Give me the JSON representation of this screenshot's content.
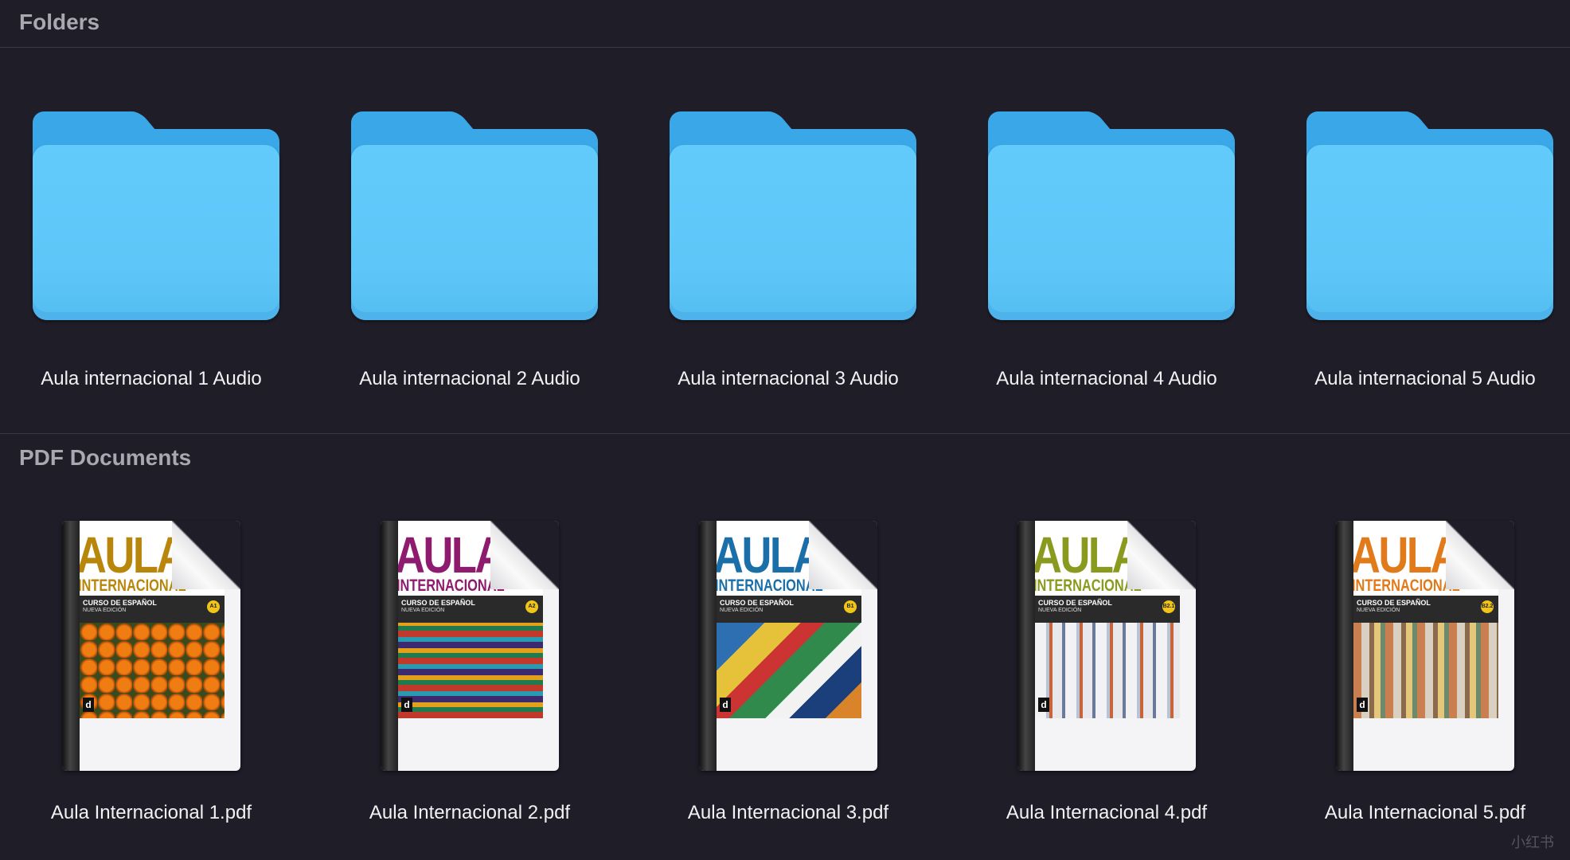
{
  "sections": {
    "folders": {
      "title": "Folders",
      "items": [
        {
          "label": "Aula internacional 1 Audio",
          "icon": "folder-icon",
          "color": "#5ec6f8"
        },
        {
          "label": "Aula internacional 2 Audio",
          "icon": "folder-icon",
          "color": "#5ec6f8"
        },
        {
          "label": "Aula internacional 3 Audio",
          "icon": "folder-icon",
          "color": "#5ec6f8"
        },
        {
          "label": "Aula internacional 4 Audio",
          "icon": "folder-icon",
          "color": "#5ec6f8"
        },
        {
          "label": "Aula internacional 5 Audio",
          "icon": "folder-icon",
          "color": "#5ec6f8"
        }
      ]
    },
    "pdfs": {
      "title": "PDF Documents",
      "items": [
        {
          "label": "Aula Internacional 1.pdf",
          "icon": "pdf-document-icon",
          "cover": {
            "title": "AULA",
            "subtitle": "INTERNACIONAL",
            "band_text": "CURSO DE ESPAÑOL",
            "band_sub": "NUEVA EDICIÓN",
            "level": "A1",
            "accent": "#b8860b",
            "level_color": "#f0c419",
            "photo": "oranges"
          }
        },
        {
          "label": "Aula Internacional 2.pdf",
          "icon": "pdf-document-icon",
          "cover": {
            "title": "AULA",
            "subtitle": "INTERNACIONAL",
            "band_text": "CURSO DE ESPAÑOL",
            "band_sub": "NUEVA EDICIÓN",
            "level": "A2",
            "accent": "#8e1b6e",
            "level_color": "#f0c419",
            "photo": "textiles"
          }
        },
        {
          "label": "Aula Internacional 3.pdf",
          "icon": "pdf-document-icon",
          "cover": {
            "title": "AULA",
            "subtitle": "INTERNACIONAL",
            "band_text": "CURSO DE ESPAÑOL",
            "band_sub": "NUEVA EDICIÓN",
            "level": "B1",
            "accent": "#1b6fa8",
            "level_color": "#f0c419",
            "photo": "mosaic"
          }
        },
        {
          "label": "Aula Internacional 4.pdf",
          "icon": "pdf-document-icon",
          "cover": {
            "title": "AULA",
            "subtitle": "INTERNACIONAL",
            "band_text": "CURSO DE ESPAÑOL",
            "band_sub": "NUEVA EDICIÓN",
            "level": "B2.1",
            "accent": "#8a9a1e",
            "level_color": "#f0c419",
            "photo": "village"
          }
        },
        {
          "label": "Aula Internacional 5.pdf",
          "icon": "pdf-document-icon",
          "cover": {
            "title": "AULA",
            "subtitle": "INTERNACIONAL",
            "band_text": "CURSO DE ESPAÑOL",
            "band_sub": "NUEVA EDICIÓN",
            "level": "B2.2",
            "accent": "#e07a1a",
            "level_color": "#f0c419",
            "photo": "city"
          }
        }
      ]
    }
  },
  "watermark": "小红书"
}
